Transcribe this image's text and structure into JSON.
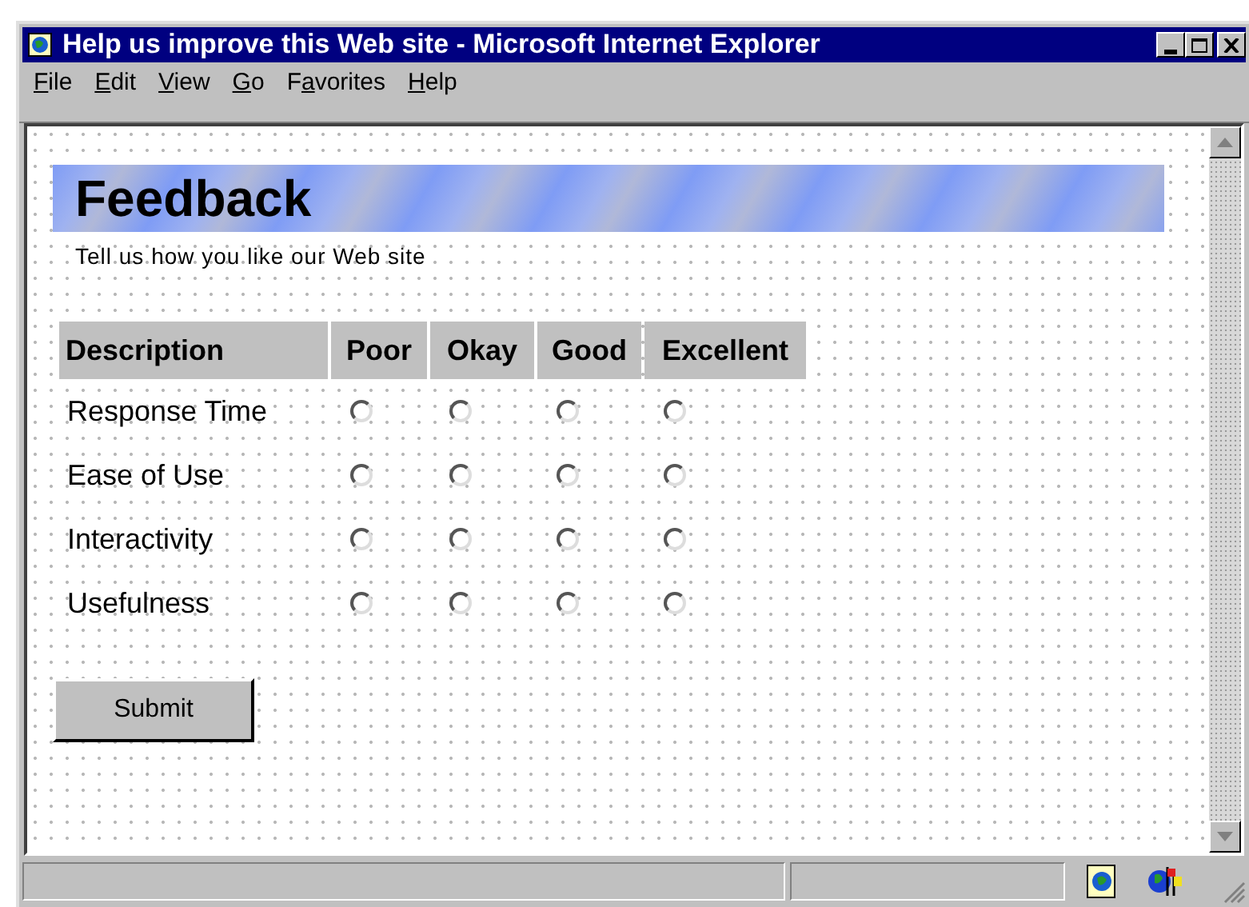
{
  "window": {
    "title": "Help us improve this Web site - Microsoft Internet Explorer"
  },
  "menu": [
    {
      "segments": [
        {
          "text": "F",
          "underlined": true
        },
        {
          "text": "ile",
          "underlined": false
        }
      ]
    },
    {
      "segments": [
        {
          "text": "E",
          "underlined": true
        },
        {
          "text": "dit",
          "underlined": false
        }
      ]
    },
    {
      "segments": [
        {
          "text": "V",
          "underlined": true
        },
        {
          "text": "iew",
          "underlined": false
        }
      ]
    },
    {
      "segments": [
        {
          "text": "G",
          "underlined": true
        },
        {
          "text": "o",
          "underlined": false
        }
      ]
    },
    {
      "segments": [
        {
          "text": "F",
          "underlined": false
        },
        {
          "text": "a",
          "underlined": true
        },
        {
          "text": "vorites",
          "underlined": false
        }
      ]
    },
    {
      "segments": [
        {
          "text": "H",
          "underlined": true
        },
        {
          "text": "elp",
          "underlined": false
        }
      ]
    }
  ],
  "page": {
    "heading": "Feedback",
    "subtitle": "Tell us how you like our Web site",
    "table": {
      "columns": [
        "Description",
        "Poor",
        "Okay",
        "Good",
        "Excellent"
      ],
      "rows": [
        {
          "label": "Response Time",
          "ratings": [
            {
              "selected": false
            },
            {
              "selected": false
            },
            {
              "selected": false
            },
            {
              "selected": false
            }
          ]
        },
        {
          "label": "Ease of Use",
          "ratings": [
            {
              "selected": false
            },
            {
              "selected": false
            },
            {
              "selected": false
            },
            {
              "selected": false
            }
          ]
        },
        {
          "label": "Interactivity",
          "ratings": [
            {
              "selected": false
            },
            {
              "selected": false
            },
            {
              "selected": false
            },
            {
              "selected": false
            }
          ]
        },
        {
          "label": "Usefulness",
          "ratings": [
            {
              "selected": false
            },
            {
              "selected": false
            },
            {
              "selected": false
            },
            {
              "selected": false
            }
          ]
        }
      ]
    },
    "submit": "Submit"
  }
}
